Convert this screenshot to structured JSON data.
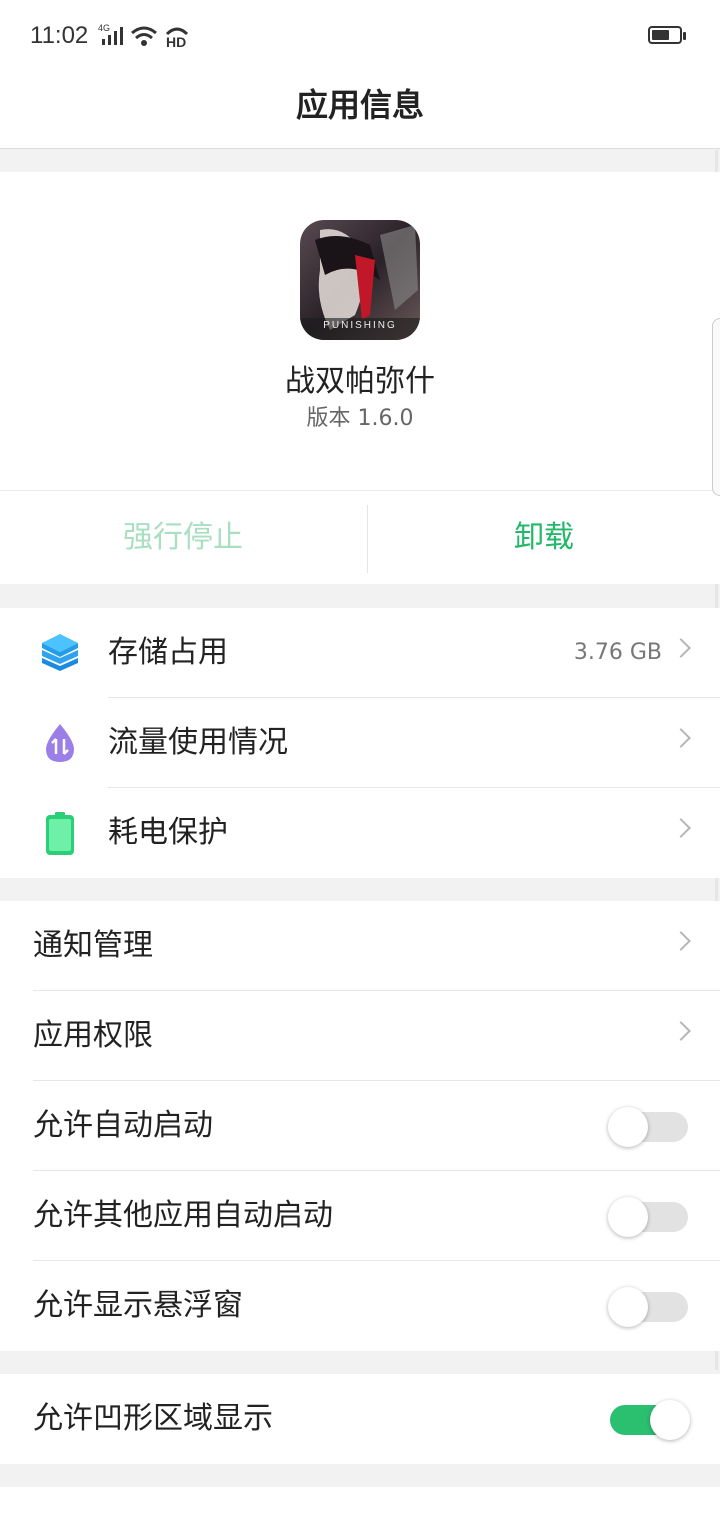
{
  "status_bar": {
    "time": "11:02",
    "network_label": "4G",
    "hd_label": "HD",
    "battery_level": 0.65
  },
  "header": {
    "title": "应用信息"
  },
  "app": {
    "name": "战双帕弥什",
    "version": "版本 1.6.0",
    "icon_text": "PUNISHING"
  },
  "actions": {
    "force_stop": "强行停止",
    "uninstall": "卸载"
  },
  "section1": {
    "items": [
      {
        "label": "存储占用",
        "value": "3.76 GB",
        "icon": "layers-icon"
      },
      {
        "label": "流量使用情况",
        "value": "",
        "icon": "data-drop-icon"
      },
      {
        "label": "耗电保护",
        "value": "",
        "icon": "battery-icon"
      }
    ]
  },
  "section2": {
    "items": [
      {
        "label": "通知管理"
      },
      {
        "label": "应用权限"
      },
      {
        "label": "允许自动启动",
        "toggle": false
      },
      {
        "label": "允许其他应用自动启动",
        "toggle": false
      },
      {
        "label": "允许显示悬浮窗",
        "toggle": false
      }
    ]
  },
  "section3": {
    "items": [
      {
        "label": "允许凹形区域显示",
        "toggle": true
      }
    ]
  },
  "colors": {
    "accent": "#23b86a",
    "accent_light": "#a8dfc0",
    "toggle_on": "#2bbf70"
  }
}
